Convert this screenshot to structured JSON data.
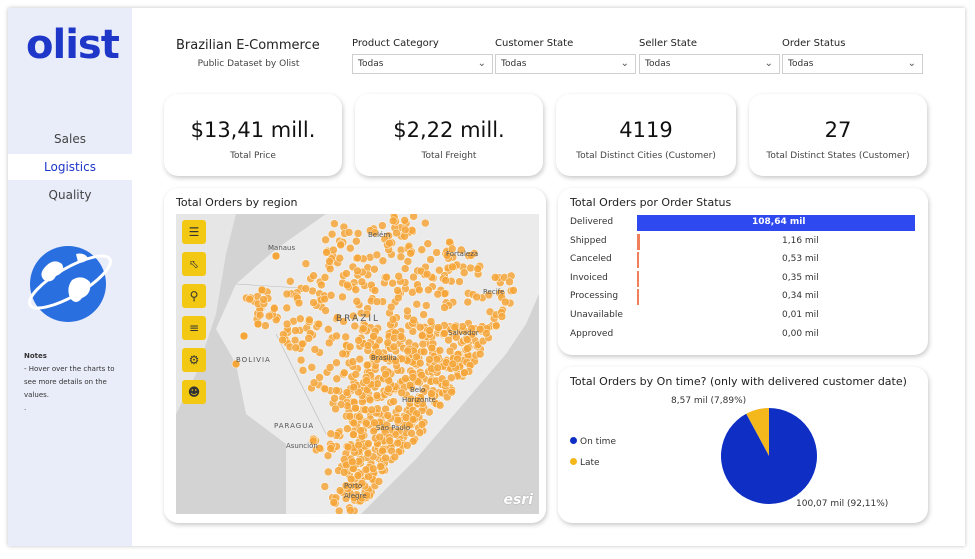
{
  "sidebar": {
    "logo": "olist",
    "nav": [
      {
        "label": "Sales",
        "active": false
      },
      {
        "label": "Logistics",
        "active": true
      },
      {
        "label": "Quality",
        "active": false
      }
    ],
    "notes_title": "Notes",
    "notes_lines": [
      "- Hover over the charts to",
      "see more details on the",
      "values.",
      "."
    ]
  },
  "header": {
    "title": "Brazilian E-Commerce",
    "subtitle": "Public Dataset by Olist"
  },
  "filters": [
    {
      "label": "Product Category",
      "value": "Todas"
    },
    {
      "label": "Customer State",
      "value": "Todas"
    },
    {
      "label": "Seller State",
      "value": "Todas"
    },
    {
      "label": "Order Status",
      "value": "Todas"
    }
  ],
  "kpis": [
    {
      "value": "$13,41 mill.",
      "label": "Total Price"
    },
    {
      "value": "$2,22 mill.",
      "label": "Total Freight"
    },
    {
      "value": "4119",
      "label": "Total Distinct Cities (Customer)"
    },
    {
      "value": "27",
      "label": "Total Distinct States (Customer)"
    }
  ],
  "map": {
    "title": "Total Orders by region",
    "cities": [
      "Manaus",
      "Belém",
      "Fortaleza",
      "Recife",
      "BRAZIL",
      "Salvador",
      "BOLIVIA",
      "Brasília",
      "Belo",
      "Horizonte",
      "PARAGUA",
      "São Paulo",
      "Asunción",
      "Porto",
      "Alegre"
    ],
    "attribution": "esri",
    "point_color": "#f5a63a"
  },
  "status_chart": {
    "title": "Total Orders por Order Status"
  },
  "pie_chart": {
    "title": "Total Orders by On time? (only with delivered customer date)"
  },
  "chart_data": [
    {
      "type": "bar",
      "title": "Total Orders por Order Status",
      "categories": [
        "Delivered",
        "Shipped",
        "Canceled",
        "Invoiced",
        "Processing",
        "Unavailable",
        "Approved"
      ],
      "values": [
        108.64,
        1.16,
        0.53,
        0.35,
        0.34,
        0.01,
        0.0
      ],
      "labels": [
        "108,64 mil",
        "1,16 mil",
        "0,53 mil",
        "0,35 mil",
        "0,34 mil",
        "0,01 mil",
        "0,00 mil"
      ],
      "colors": {
        "main": "#2e49ef",
        "small": "#f07f5c"
      }
    },
    {
      "type": "pie",
      "title": "Total Orders by On time? (only with delivered customer date)",
      "categories": [
        "On time",
        "Late"
      ],
      "values": [
        100.07,
        8.57
      ],
      "percents": [
        92.11,
        7.89
      ],
      "labels": [
        "100,07 mil (92,11%)",
        "8,57 mil (7,89%)"
      ],
      "colors": [
        "#0f2fc4",
        "#f5b81c"
      ]
    }
  ]
}
